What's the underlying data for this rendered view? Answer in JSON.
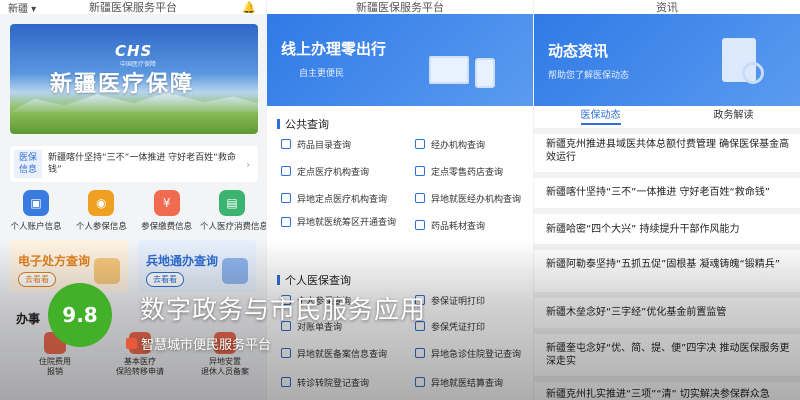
{
  "p1": {
    "topbar": {
      "location": "新疆",
      "title": "新疆医保服务平台",
      "bell": "bell-icon"
    },
    "banner": {
      "logo": "CHS",
      "logo_sub": "中国医疗保障",
      "title": "新疆医疗保障"
    },
    "news": {
      "tag1": "医保",
      "tag2": "信息",
      "text": "新疆喀什坚持“三不”一体推进 守好老百姓“救命钱”"
    },
    "icons": [
      {
        "label": "个人账户信息",
        "color": "#3a7be0"
      },
      {
        "label": "个人参保信息",
        "color": "#f0a020"
      },
      {
        "label": "参保缴费信息",
        "color": "#f06b4f"
      },
      {
        "label": "个人医疗消费信息",
        "color": "#3cb371"
      }
    ],
    "card_rx": {
      "title": "电子处方查询",
      "button": "去看看"
    },
    "card_tong": {
      "title": "兵地通办查询",
      "button": "去看看"
    },
    "section": "办事",
    "bottom": [
      {
        "l1": "住院费用",
        "l2": "报销"
      },
      {
        "l1": "基本医疗",
        "l2": "保险转移申请"
      },
      {
        "l1": "异地安置",
        "l2": "退休人员备案"
      }
    ]
  },
  "p2": {
    "topbar": {
      "title": "新疆医保服务平台"
    },
    "banner": {
      "title": "线上办理零出行",
      "sub": "自主更便民"
    },
    "group1": {
      "title": "公共查询",
      "items": [
        "药品目录查询",
        "经办机构查询",
        "定点医疗机构查询",
        "定点零售药店查询",
        "异地定点医疗机构查询",
        "异地就医经办机构查询",
        "异地就医统筹区开通查询",
        "药品耗材查询"
      ]
    },
    "group2": {
      "title": "个人医保查询",
      "items": [
        "个人参保查询",
        "参保证明打印",
        "对账单查询",
        "参保凭证打印",
        "异地就医备案信息查询",
        "异地急诊住院登记查询",
        "转诊转院登记查询",
        "异地就医结算查询"
      ]
    }
  },
  "p3": {
    "topbar": {
      "title": "资讯"
    },
    "banner": {
      "title": "动态资讯",
      "sub": "帮助您了解医保动态"
    },
    "tabs": [
      "医保动态",
      "政务解读"
    ],
    "news": [
      "新疆克州推进县域医共体总额付费管理 确保医保基金高效运行",
      "新疆喀什坚持“三不”一体推进 守好老百姓“救命钱”",
      "新疆哈密“四个大兴” 持续提升干部作风能力",
      "新疆阿勒泰坚持“五抓五促”固根基 凝魂铸魄“锻精兵”",
      "新疆木垒念好“三字经”优化基金前置监管",
      "新疆奎屯念好“优、简、提、便”四字决 推动医保服务更深走实",
      "新疆克州扎实推进“三项”“清” 切实解决参保群众急"
    ]
  },
  "overlay": {
    "score": "9.8",
    "title": "数字政务与市民服务应用",
    "subtitle": "智慧城市便民服务平台"
  }
}
